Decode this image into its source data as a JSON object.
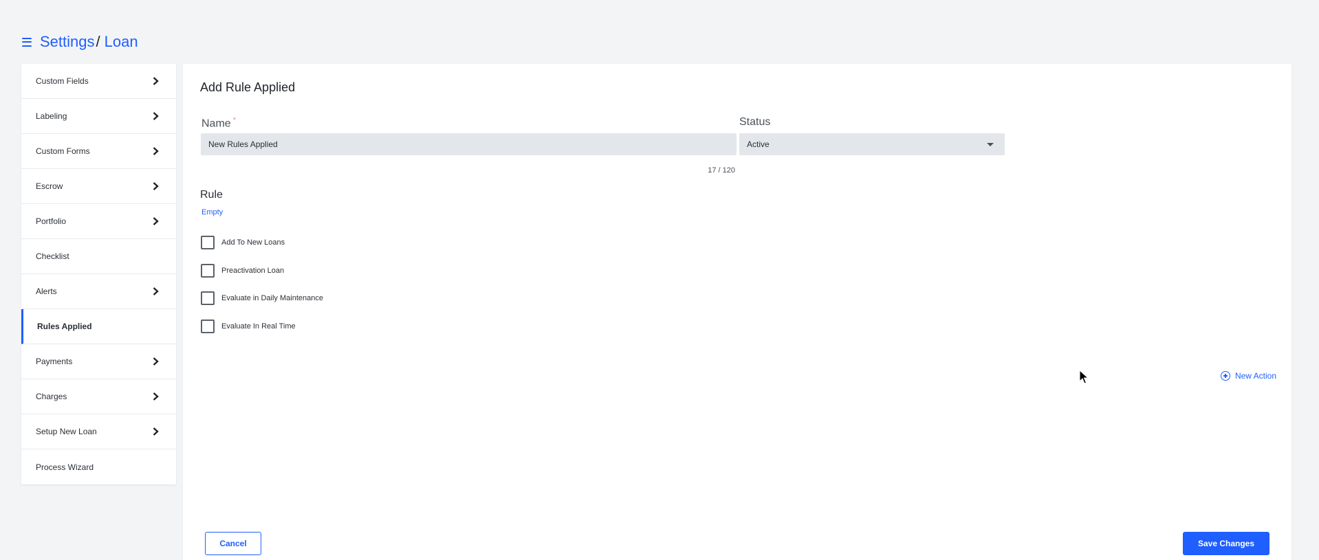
{
  "breadcrumb": {
    "root": "Settings",
    "separator": "/",
    "current": "Loan"
  },
  "sidebar": {
    "items": [
      {
        "label": "Custom Fields",
        "has_chevron": true
      },
      {
        "label": "Labeling",
        "has_chevron": true
      },
      {
        "label": "Custom Forms",
        "has_chevron": true
      },
      {
        "label": "Escrow",
        "has_chevron": true
      },
      {
        "label": "Portfolio",
        "has_chevron": true
      },
      {
        "label": "Checklist",
        "has_chevron": false
      },
      {
        "label": "Alerts",
        "has_chevron": true
      },
      {
        "label": "Rules Applied",
        "has_chevron": false,
        "active": true
      },
      {
        "label": "Payments",
        "has_chevron": true
      },
      {
        "label": "Charges",
        "has_chevron": true
      },
      {
        "label": "Setup New Loan",
        "has_chevron": true
      },
      {
        "label": "Process Wizard",
        "has_chevron": false
      }
    ]
  },
  "form": {
    "title": "Add Rule Applied",
    "name_label": "Name",
    "required_marker": "*",
    "name_value": "New Rules Applied",
    "name_counter": "17 / 120",
    "status_label": "Status",
    "status_value": "Active",
    "rule_label": "Rule",
    "rule_empty": "Empty",
    "checkboxes": [
      {
        "label": "Add To New Loans",
        "checked": false
      },
      {
        "label": "Preactivation Loan",
        "checked": false
      },
      {
        "label": "Evaluate in Daily Maintenance",
        "checked": false
      },
      {
        "label": "Evaluate In Real Time",
        "checked": false
      }
    ],
    "new_action_label": "New Action",
    "cancel_label": "Cancel",
    "save_label": "Save Changes"
  },
  "colors": {
    "accent": "#1f5eff",
    "background": "#f3f4f6",
    "input_bg": "#e3e6ea"
  }
}
